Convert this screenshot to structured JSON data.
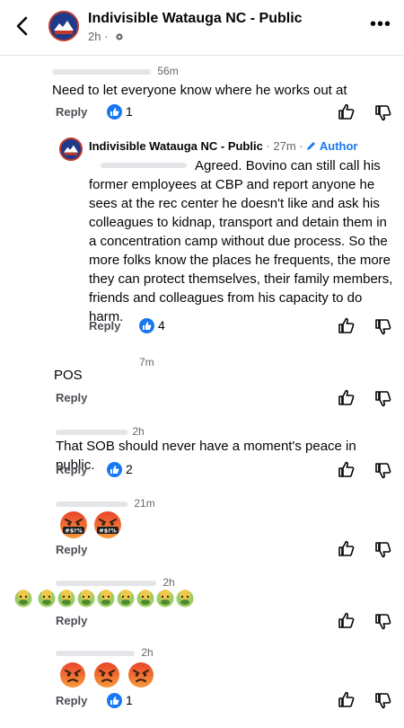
{
  "header": {
    "title": "Indivisible Watauga NC - Public",
    "time": "2h ·",
    "logo_text": "INDIVISIBLE"
  },
  "comments": [
    {
      "time": "56m",
      "text": "Need to let everyone know where he works out at",
      "reply_label": "Reply",
      "likes": "1"
    },
    {
      "author": "Indivisible Watauga NC - Public",
      "time": "· 27m ·",
      "badge": "Author",
      "text": "Agreed. Bovino can still call his former employees at CBP and report anyone he sees at the rec center he doesn't like  and ask his colleagues to kidnap, transport and detain them  in a concentration camp without due process. So the more folks know the places he frequents, the more they can protect themselves, their family members, friends and colleagues from his capacity to do harm.",
      "reply_label": "Reply",
      "likes": "4"
    },
    {
      "time": "7m",
      "text": "POS",
      "reply_label": "Reply"
    },
    {
      "time": "2h",
      "text": "That SOB should never have a moment's peace in public.",
      "reply_label": "Reply",
      "likes": "2"
    },
    {
      "time": "21m",
      "reply_label": "Reply",
      "emoji_symbol": "#$!%"
    },
    {
      "time": "2h",
      "reply_label": "Reply"
    },
    {
      "time": "2h",
      "reply_label": "Reply",
      "likes": "1"
    }
  ],
  "colors": {
    "brand_blue": "#1877f2",
    "angry_red": "#e8442b",
    "angry_orange": "#f79a3b",
    "nausea_green": "#6aa84f"
  }
}
